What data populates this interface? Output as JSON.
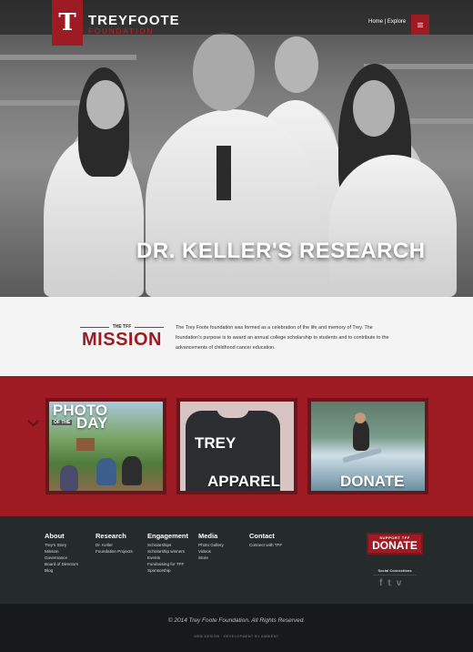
{
  "header": {
    "logo_glyph": "T",
    "brand_name": "TREYFOOTE",
    "brand_sub": "FOUNDATION",
    "nav": {
      "home": "Home",
      "separator": "|",
      "explore": "Explore"
    },
    "menu_icon": "hamburger-icon"
  },
  "hero": {
    "title": "DR. KELLER'S RESEARCH"
  },
  "mission": {
    "kicker": "THE TFF",
    "title": "MISSION",
    "text": "The Trey Foote foundation was formed as a celebration of the life and memory of Trey. The foundation's purpose is to award an annual college scholarship to students and to contribute to the advancements of childhood cancer education."
  },
  "features": {
    "cards": [
      {
        "line1": "PHOTO",
        "line2": "OF THE",
        "line3": "DAY"
      },
      {
        "overlay": "TREY",
        "title": "APPAREL"
      },
      {
        "title": "DONATE"
      }
    ]
  },
  "footer": {
    "columns": [
      {
        "heading": "About",
        "links": [
          "Trey's Story",
          "Mission",
          "Governance",
          "Board of Directors",
          "Blog"
        ]
      },
      {
        "heading": "Research",
        "links": [
          "Dr. Keller",
          "Foundation Projects"
        ]
      },
      {
        "heading": "Engagement",
        "links": [
          "Scholarships",
          "Scholarship winners",
          "Events",
          "Fundraising for TFF",
          "Sponsorship"
        ]
      },
      {
        "heading": "Media",
        "links": [
          "Photo Gallery",
          "Videos",
          "Store"
        ]
      },
      {
        "heading": "Contact",
        "links": [
          "Connect with TFF"
        ]
      }
    ],
    "donate": {
      "small": "SUPPORT TFF",
      "big": "DONATE"
    },
    "social": {
      "label": "Social Connections",
      "icons": [
        "facebook-icon",
        "twitter-icon",
        "vimeo-icon"
      ],
      "glyphs": [
        "f",
        "t",
        "v"
      ]
    },
    "copyright": "© 2014 Trey Foote Foundation. All Rights Reserved.",
    "credit": "WEB DESIGN · DEVELOPMENT BY AMBIENT"
  },
  "colors": {
    "brand_red": "#9e1b24",
    "footer_bg": "#252b2b",
    "bottom_bg": "#171a1a"
  }
}
